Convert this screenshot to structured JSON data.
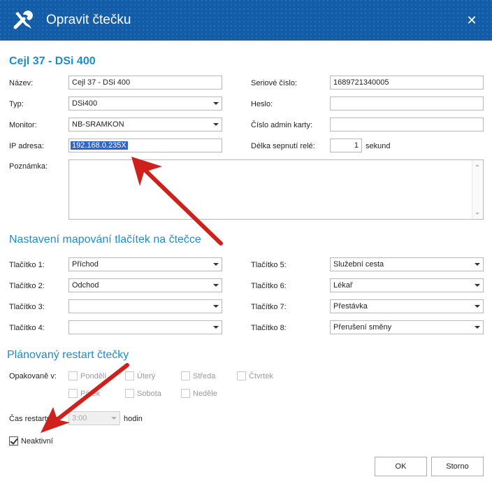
{
  "window": {
    "title": "Opravit čtečku"
  },
  "reader": {
    "heading": "Cejl 37 - DSi 400",
    "name_label": "Název:",
    "name_value": "Cejl 37 - DSi 400",
    "type_label": "Typ:",
    "type_value": "DSi400",
    "monitor_label": "Monitor:",
    "monitor_value": "NB-SRAMKON",
    "ip_label": "IP adresa:",
    "ip_value": "192.168.0.235X",
    "note_label": "Poznámka:",
    "note_value": "",
    "serial_label": "Seriové číslo:",
    "serial_value": "1689721340005",
    "password_label": "Heslo:",
    "password_value": "",
    "admin_card_label": "Číslo admin karty:",
    "admin_card_value": "",
    "relay_label": "Délka sepnutí relé:",
    "relay_value": "1",
    "relay_unit": "sekund"
  },
  "mapping": {
    "heading": "Nastavení mapování tlačítek na čtečce",
    "buttons": [
      {
        "label": "Tlačítko 1:",
        "value": "Příchod"
      },
      {
        "label": "Tlačítko 2:",
        "value": "Odchod"
      },
      {
        "label": "Tlačítko 3:",
        "value": ""
      },
      {
        "label": "Tlačítko 4:",
        "value": ""
      },
      {
        "label": "Tlačítko 5:",
        "value": "Služební cesta"
      },
      {
        "label": "Tlačítko 6:",
        "value": "Lékař"
      },
      {
        "label": "Tlačítko 7:",
        "value": "Přestávka"
      },
      {
        "label": "Tlačítko 8:",
        "value": "Přerušení směny"
      }
    ]
  },
  "restart": {
    "heading": "Plánovaný restart čtečky",
    "repeat_label": "Opakovaně v:",
    "days": [
      "Pondělí",
      "Úterý",
      "Středa",
      "Čtvrtek",
      "Pátek",
      "Sobota",
      "Neděle"
    ],
    "time_label": "Čas restartu v:",
    "time_value": "3:00",
    "time_unit": "hodin",
    "inactive_label": "Neaktivní",
    "inactive_checked": true
  },
  "footer": {
    "ok_label": "OK",
    "cancel_label": "Storno"
  },
  "colors": {
    "titlebar": "#135ca8",
    "heading": "#1d8ccd",
    "annotation_arrow": "#d0201c"
  }
}
